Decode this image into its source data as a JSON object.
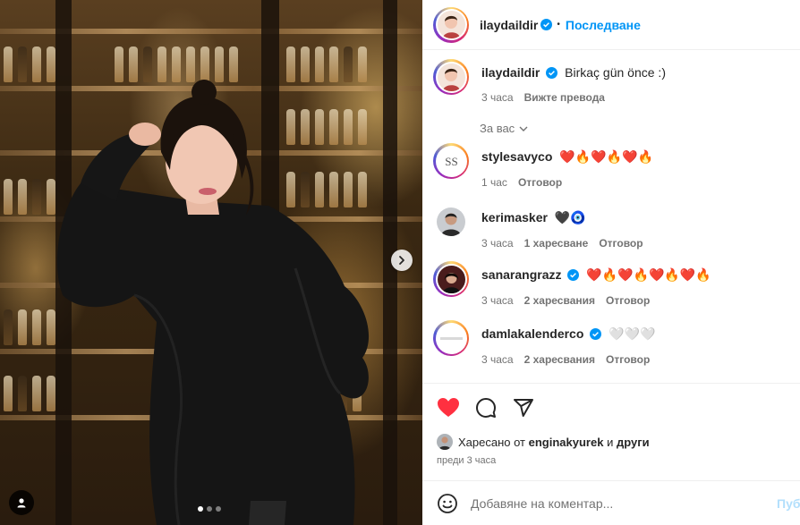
{
  "post": {
    "author": "ilaydaildir",
    "follow_label": "Последване",
    "caption_text": "Birkaç gün önce :)",
    "caption_time": "3 часа",
    "translate_label": "Вижте превода",
    "carousel": {
      "slide_count": 3,
      "active_index": 0
    }
  },
  "sort_label": "За вас",
  "comments": [
    {
      "user": "stylesavyco",
      "text": "❤️🔥❤️🔥❤️🔥",
      "time": "1 час",
      "likes": "",
      "reply": "Отговор"
    },
    {
      "user": "kerimasker",
      "text": "🖤🧿",
      "time": "3 часа",
      "likes": "1 харесване",
      "reply": "Отговор"
    },
    {
      "user": "sanarangrazz",
      "text": "❤️🔥❤️🔥❤️🔥❤️🔥",
      "time": "3 часа",
      "likes": "2 харесвания",
      "reply": "Отговор",
      "verified": true
    },
    {
      "user": "damlakalenderco",
      "text": "🤍🤍🤍",
      "time": "3 часа",
      "likes": "2 харесвания",
      "reply": "Отговор",
      "verified": true
    }
  ],
  "likes_line": {
    "prefix": "Харесано от",
    "user": "enginakyurek",
    "conj": "и",
    "others": "други"
  },
  "post_time": "преди 3 часа",
  "composer": {
    "placeholder": "Добавяне на коментар...",
    "post_label": "Публикуване"
  },
  "colors": {
    "accent": "#0095f6",
    "like_red": "#ff3040",
    "muted": "#737373"
  },
  "icons": [
    "verified-icon",
    "chevron-down-icon",
    "heart-icon",
    "comment-icon",
    "share-icon",
    "emoji-icon",
    "next-arrow-icon",
    "user-tag-icon"
  ]
}
